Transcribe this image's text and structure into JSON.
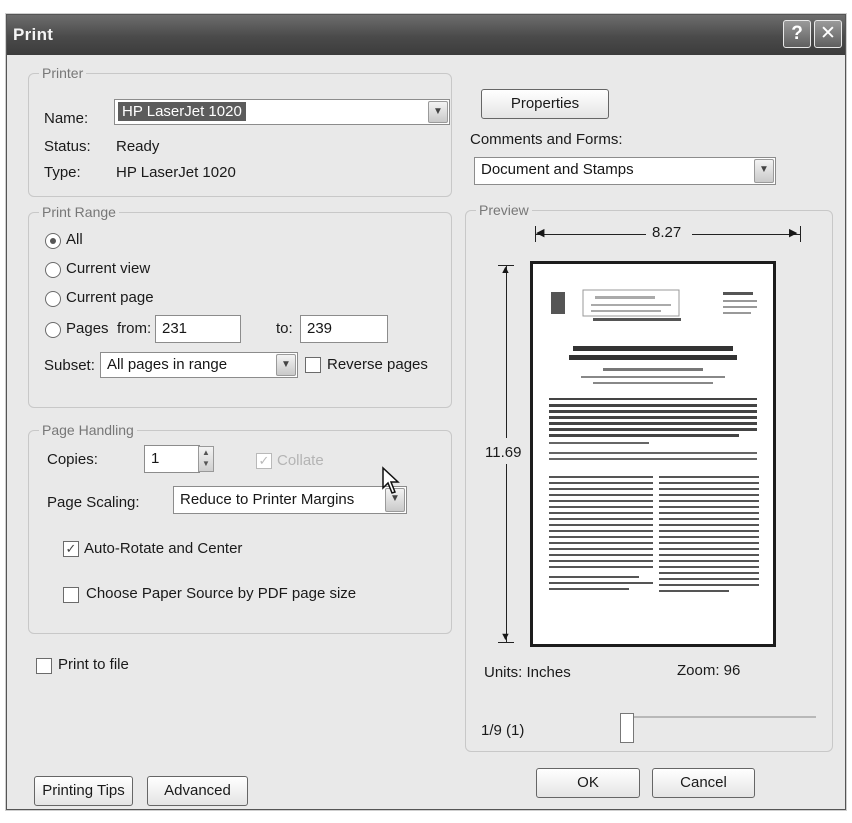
{
  "window": {
    "title": "Print"
  },
  "icons": {
    "help": "help-icon",
    "close": "close-icon"
  },
  "printer": {
    "legend": "Printer",
    "name_label": "Name:",
    "name_value": "HP LaserJet 1020",
    "status_label": "Status:",
    "status_value": "Ready",
    "type_label": "Type:",
    "type_value": "HP LaserJet 1020",
    "properties_button": "Properties",
    "comments_label": "Comments and Forms:",
    "comments_value": "Document and Stamps"
  },
  "print_range": {
    "legend": "Print Range",
    "options": {
      "all": "All",
      "current_view": "Current view",
      "current_page": "Current page",
      "pages": "Pages"
    },
    "selected": "all",
    "from_label": "from:",
    "from_value": "231",
    "to_label": "to:",
    "to_value": "239",
    "subset_label": "Subset:",
    "subset_value": "All pages in range",
    "reverse_label": "Reverse pages"
  },
  "page_handling": {
    "legend": "Page Handling",
    "copies_label": "Copies:",
    "copies_value": "1",
    "collate_label": "Collate",
    "scaling_label": "Page Scaling:",
    "scaling_value": "Reduce to Printer Margins",
    "auto_rotate_label": "Auto-Rotate and Center",
    "paper_source_label": "Choose Paper Source by PDF page size"
  },
  "print_to_file_label": "Print to file",
  "preview": {
    "legend": "Preview",
    "width": "8.27",
    "height": "11.69",
    "units": "Units: Inches",
    "zoom": "Zoom: 96",
    "page_indicator": "1/9 (1)"
  },
  "buttons": {
    "printing_tips": "Printing Tips",
    "advanced": "Advanced",
    "ok": "OK",
    "cancel": "Cancel"
  }
}
